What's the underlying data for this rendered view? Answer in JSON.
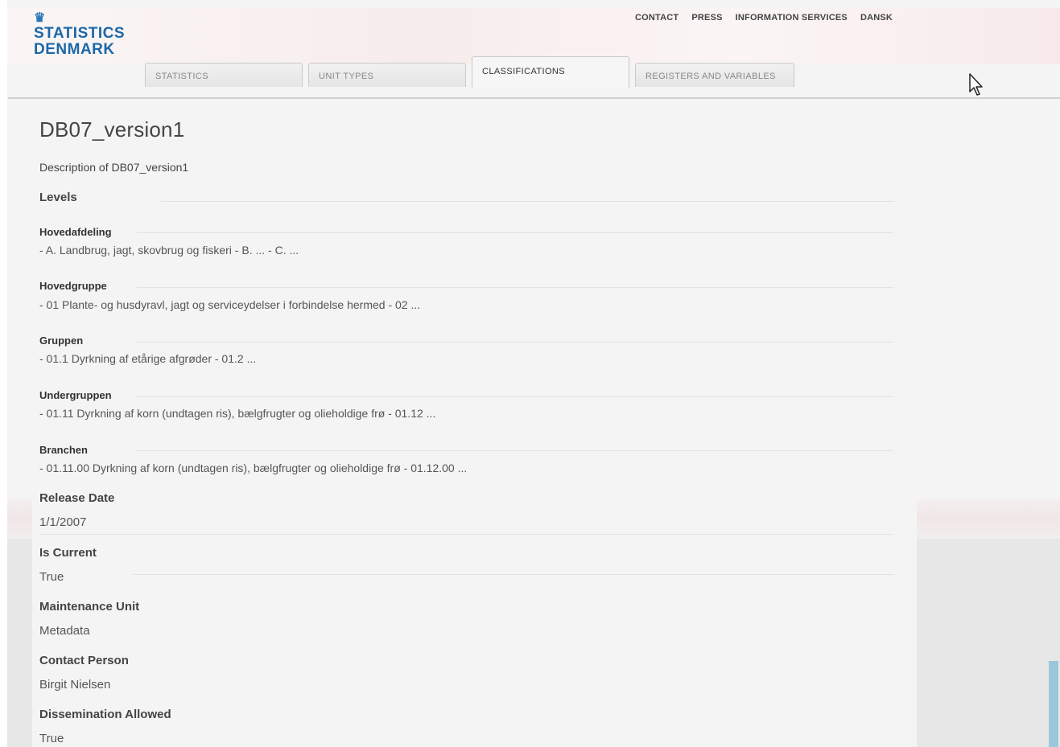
{
  "header": {
    "logo": {
      "line1": "STATISTICS",
      "line2": "DENMARK",
      "crown": "♛"
    },
    "top_links": [
      "CONTACT",
      "PRESS",
      "INFORMATION SERVICES",
      "DANSK"
    ],
    "tabs": [
      {
        "label": "STATISTICS",
        "active": false
      },
      {
        "label": "UNIT TYPES",
        "active": false
      },
      {
        "label": "CLASSIFICATIONS",
        "active": true
      },
      {
        "label": "REGISTERS AND VARIABLES",
        "active": false
      }
    ]
  },
  "main": {
    "title": "DB07_version1",
    "description": "Description of DB07_version1",
    "levels_heading": "Levels",
    "levels": [
      {
        "name": "Hovedafdeling",
        "value": "- A. Landbrug, jagt, skovbrug og fiskeri - B. ... - C. ..."
      },
      {
        "name": "Hovedgruppe",
        "value": "- 01 Plante- og husdyravl, jagt og serviceydelser i forbindelse hermed - 02 ..."
      },
      {
        "name": "Gruppen",
        "value": "- 01.1 Dyrkning af etårige afgrøder - 01.2 ..."
      },
      {
        "name": "Undergruppen",
        "value": "- 01.11 Dyrkning af korn (undtagen ris), bælgfrugter og olieholdige frø - 01.12 ..."
      },
      {
        "name": "Branchen",
        "value": "- 01.11.00 Dyrkning af korn (undtagen ris), bælgfrugter og olieholdige frø - 01.12.00 ..."
      }
    ],
    "properties": [
      {
        "label": "Release Date",
        "value": "1/1/2007"
      },
      {
        "label": "Is Current",
        "value": "True"
      },
      {
        "label": "Maintenance Unit",
        "value": "Metadata"
      },
      {
        "label": "Contact Person",
        "value": "Birgit Nielsen"
      },
      {
        "label": "Dissemination Allowed",
        "value": "True"
      }
    ]
  },
  "colors": {
    "brand": "#1b67a8",
    "text": "#444444",
    "background": "#f4f4f4"
  }
}
